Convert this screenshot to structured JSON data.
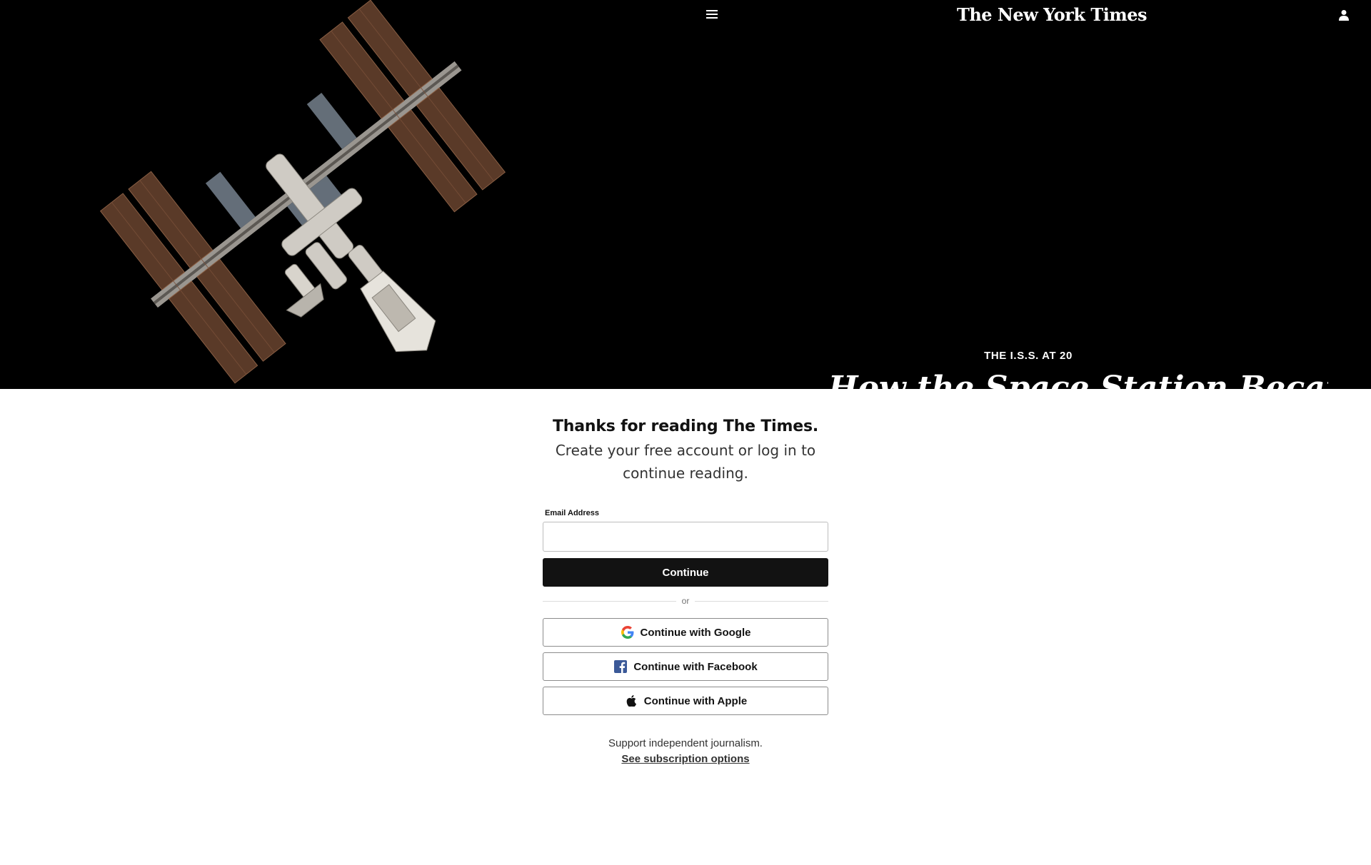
{
  "header": {
    "menu_icon": "hamburger-menu-icon",
    "masthead": "The New York Times",
    "account_icon": "user-account-icon"
  },
  "hero": {
    "kicker": "THE I.S.S. AT 20",
    "headline": "How the Space Station Became a"
  },
  "regwall": {
    "title": "Thanks for reading The Times.",
    "subtitle_line1": "Create your free account or log in to",
    "subtitle_line2": "continue reading.",
    "email_label": "Email Address",
    "email_value": "",
    "continue_label": "Continue",
    "or_label": "or",
    "google_label": "Continue with Google",
    "facebook_label": "Continue with Facebook",
    "apple_label": "Continue with Apple",
    "support_text": "Support independent journalism.",
    "subscription_link": "See subscription options"
  },
  "colors": {
    "hero_background": "#000000",
    "button_dark": "#121212",
    "facebook_blue": "#3b5998"
  }
}
